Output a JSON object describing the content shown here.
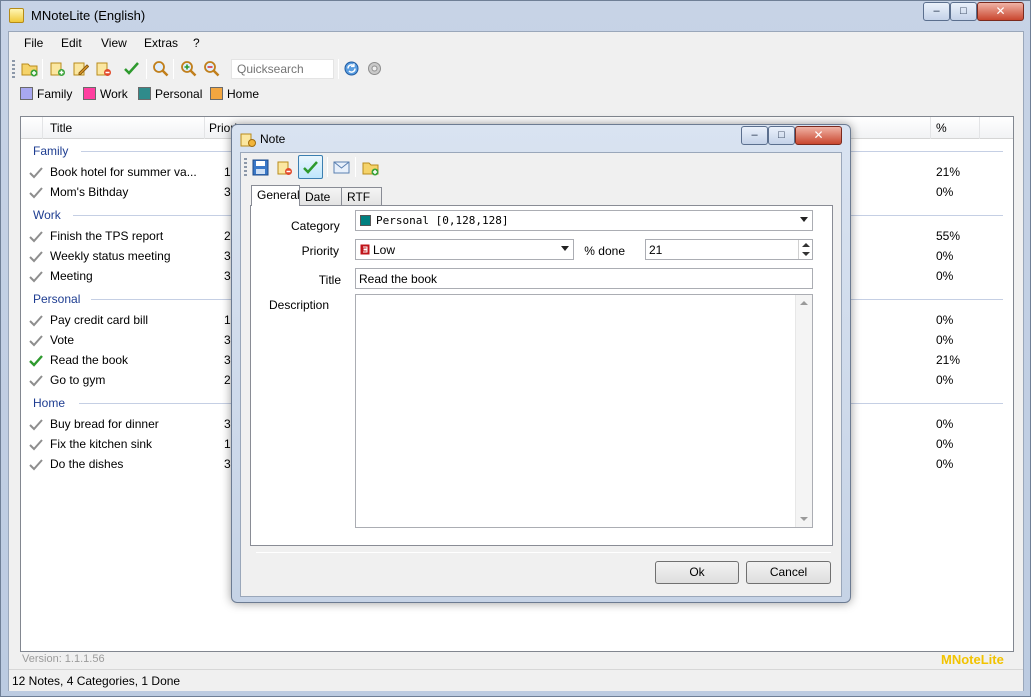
{
  "main_window": {
    "title": "MNoteLite (English)",
    "controls": {
      "minimize": "–",
      "maximize": "□",
      "close": "✕"
    }
  },
  "menu": [
    {
      "label": "File"
    },
    {
      "label": "Edit"
    },
    {
      "label": "View"
    },
    {
      "label": "Extras"
    },
    {
      "label": "?"
    }
  ],
  "toolbar": {
    "icons": [
      "new-category-icon",
      "new-note-icon",
      "edit-note-icon",
      "delete-note-icon",
      "done-check-icon",
      "search-icon",
      "zoom-in-icon",
      "zoom-out-icon",
      "sync-icon",
      "settings-icon"
    ],
    "quicksearch_placeholder": "Quicksearch"
  },
  "categories": [
    {
      "label": "Family",
      "color": "#a8a8f0"
    },
    {
      "label": "Work",
      "color": "#ff3fa0"
    },
    {
      "label": "Personal",
      "color": "#2f8b8b"
    },
    {
      "label": "Home",
      "color": "#f2a640"
    }
  ],
  "list": {
    "columns": {
      "title": "Title",
      "priority": "Priori",
      "percent": "%"
    },
    "groups": [
      {
        "name": "Family",
        "rows": [
          {
            "title": "Book hotel for summer va...",
            "priority": "1",
            "percent": "21%",
            "done": false
          },
          {
            "title": "Mom's Bithday",
            "priority": "3",
            "percent": "0%",
            "done": false
          }
        ]
      },
      {
        "name": "Work",
        "rows": [
          {
            "title": "Finish the TPS report",
            "priority": "2",
            "percent": "55%",
            "done": false
          },
          {
            "title": "Weekly status meeting",
            "priority": "3",
            "percent": "0%",
            "done": false
          },
          {
            "title": "Meeting",
            "priority": "3",
            "percent": "0%",
            "done": false
          }
        ]
      },
      {
        "name": "Personal",
        "rows": [
          {
            "title": "Pay credit card bill",
            "priority": "1",
            "percent": "0%",
            "done": false
          },
          {
            "title": "Vote",
            "priority": "3",
            "percent": "0%",
            "done": false
          },
          {
            "title": "Read the book",
            "priority": "3",
            "percent": "21%",
            "done": true
          },
          {
            "title": "Go to gym",
            "priority": "2",
            "percent": "0%",
            "done": false
          }
        ]
      },
      {
        "name": "Home",
        "rows": [
          {
            "title": "Buy bread for dinner",
            "priority": "3",
            "percent": "0%",
            "done": false
          },
          {
            "title": "Fix the kitchen sink",
            "priority": "1",
            "percent": "0%",
            "done": false
          },
          {
            "title": "Do the dishes",
            "priority": "3",
            "percent": "0%",
            "done": false
          }
        ]
      }
    ]
  },
  "footer": {
    "version": "Version: 1.1.1.56",
    "brand": "MNoteLite",
    "status": "12 Notes, 4 Categories, 1 Done"
  },
  "note_dialog": {
    "title": "Note",
    "toolbar_icons": [
      "save-icon",
      "delete-icon",
      "done-check-icon",
      "email-icon",
      "new-folder-icon"
    ],
    "tabs": [
      {
        "label": "General"
      },
      {
        "label": "Date"
      },
      {
        "label": "RTF"
      }
    ],
    "active_tab": "General",
    "labels": {
      "category": "Category",
      "priority": "Priority",
      "percent_done": "% done",
      "title": "Title",
      "description": "Description"
    },
    "category_value": "Personal [0,128,128]",
    "category_color": "#008080",
    "priority_value": "Low",
    "priority_color": "#c0141a",
    "percent_done_value": "21",
    "title_value": "Read the book",
    "description_value": "",
    "buttons": {
      "ok": "Ok",
      "cancel": "Cancel"
    }
  }
}
